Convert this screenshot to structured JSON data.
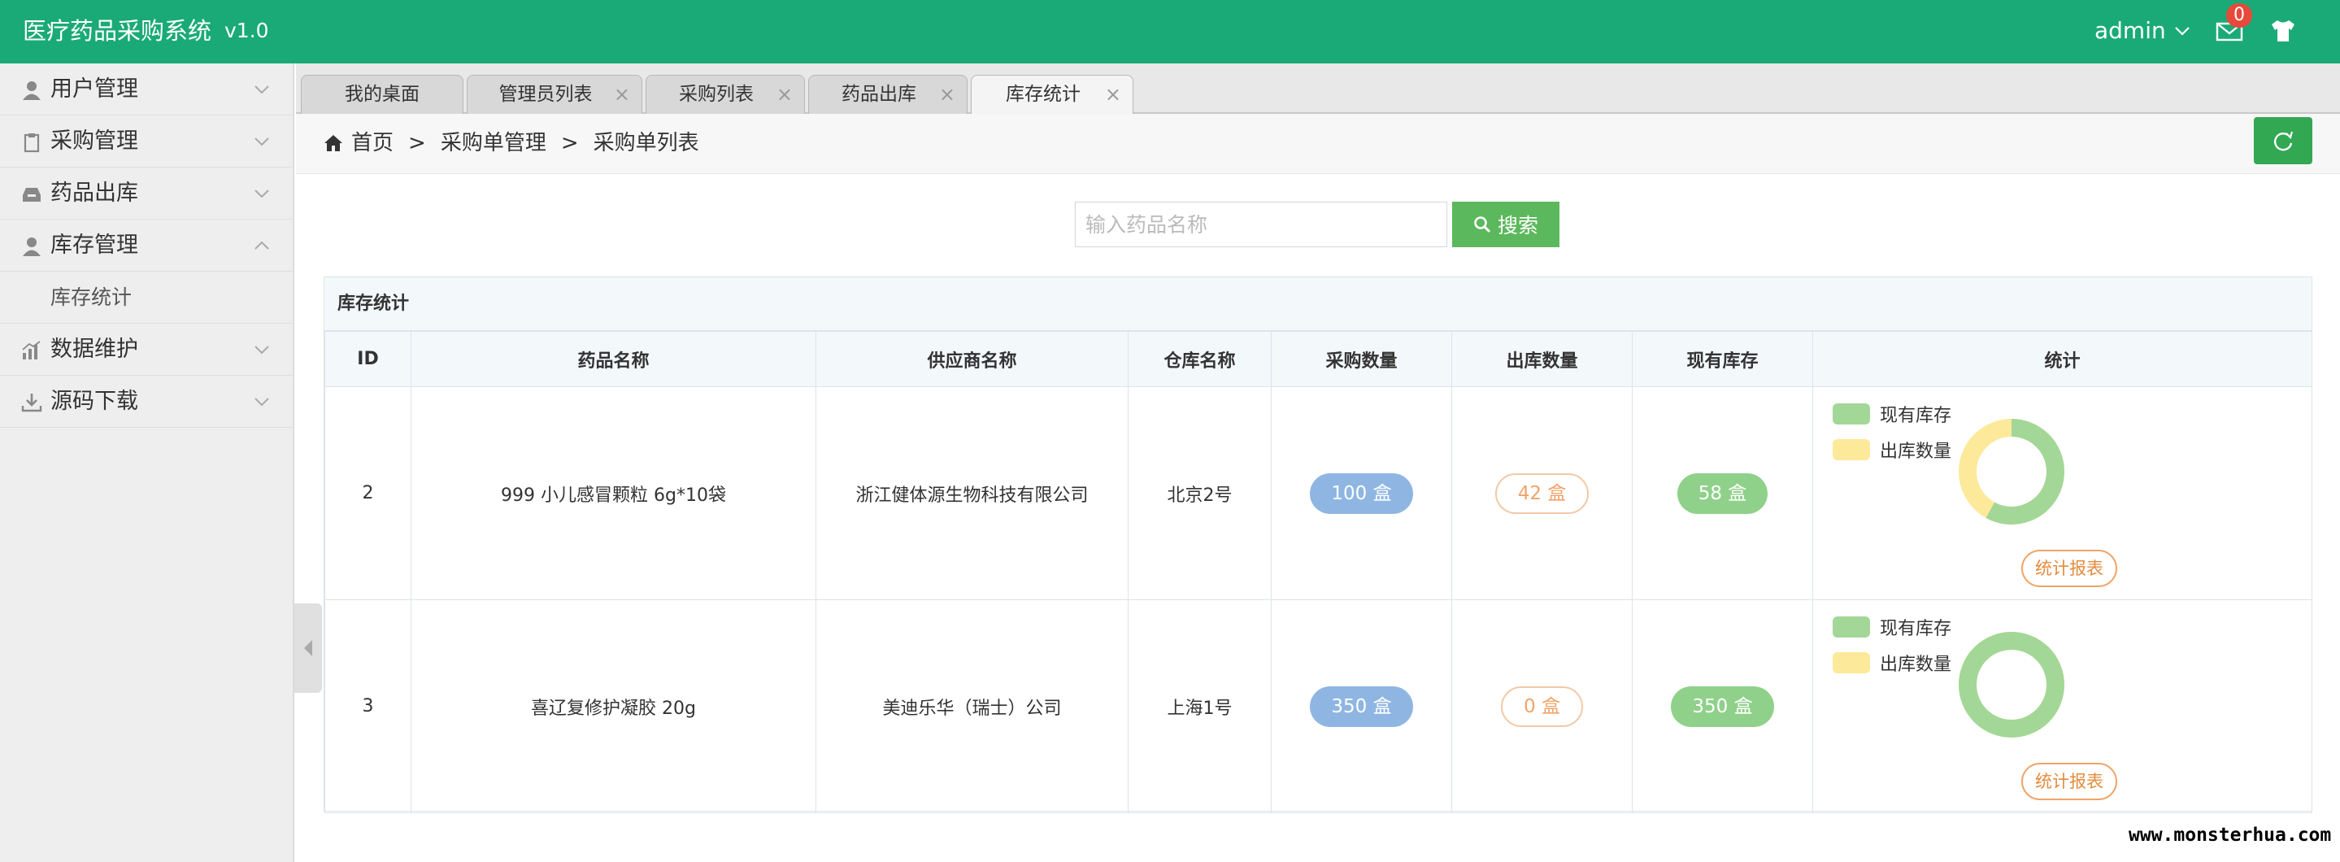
{
  "header": {
    "title": "医疗药品采购系统",
    "version": "v1.0",
    "user": "admin",
    "notifications": "0",
    "icons": [
      "mail-icon",
      "tshirt-icon"
    ]
  },
  "sidebar": {
    "items": [
      {
        "label": "用户管理",
        "icon": "user-icon",
        "expanded": false
      },
      {
        "label": "采购管理",
        "icon": "clipboard-icon",
        "expanded": false
      },
      {
        "label": "药品出库",
        "icon": "inbox-icon",
        "expanded": false
      },
      {
        "label": "库存管理",
        "icon": "user-icon",
        "expanded": true
      },
      {
        "label": "数据维护",
        "icon": "bar-chart-icon",
        "expanded": false
      },
      {
        "label": "源码下载",
        "icon": "download-icon",
        "expanded": false
      }
    ],
    "subitems": {
      "inventory_stats": "库存统计"
    }
  },
  "tabs": [
    {
      "label": "我的桌面",
      "closable": false
    },
    {
      "label": "管理员列表",
      "closable": true
    },
    {
      "label": "采购列表",
      "closable": true
    },
    {
      "label": "药品出库",
      "closable": true
    },
    {
      "label": "库存统计",
      "closable": true,
      "active": true
    }
  ],
  "breadcrumb": {
    "home": "首页",
    "level1": "采购单管理",
    "level2": "采购单列表",
    "separator": ">"
  },
  "search": {
    "placeholder": "输入药品名称",
    "value": "",
    "button": "搜索"
  },
  "panel": {
    "title": "库存统计",
    "columns": [
      "ID",
      "药品名称",
      "供应商名称",
      "仓库名称",
      "采购数量",
      "出库数量",
      "现有库存",
      "统计"
    ],
    "rows": [
      {
        "id": "2",
        "drug": "999 小儿感冒颗粒 6g*10袋",
        "supplier": "浙江健体源生物科技有限公司",
        "warehouse": "北京2号",
        "purchased": "100 盒",
        "outbound": "42 盒",
        "stock": "58 盒",
        "stock_fraction": 0.58,
        "legend_stock": "现有库存",
        "legend_out": "出库数量",
        "report": "统计报表"
      },
      {
        "id": "3",
        "drug": "喜辽复修护凝胶 20g",
        "supplier": "美迪乐华（瑞士）公司",
        "warehouse": "上海1号",
        "purchased": "350 盒",
        "outbound": "0 盒",
        "stock": "350 盒",
        "stock_fraction": 1.0,
        "legend_stock": "现有库存",
        "legend_out": "出库数量",
        "report": "统计报表"
      }
    ]
  },
  "colors": {
    "header": "#1aaa78",
    "stock": "#a3d797",
    "outbound": "#fde99a",
    "purchase_pill": "#8fb6e2"
  },
  "watermark": "www.monsterhua.com"
}
